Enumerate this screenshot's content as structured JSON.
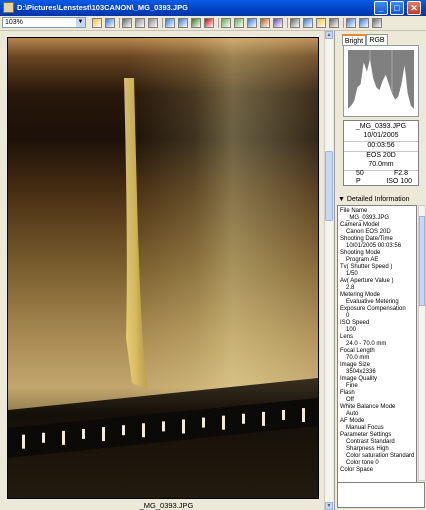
{
  "window": {
    "title": "D:\\Pictures\\Lenstest\\103CANON\\_MG_0393.JPG",
    "controls": {
      "minimize": "_",
      "maximize": "□",
      "close": "✕"
    }
  },
  "toolbar": {
    "zoom_value": "103%",
    "zoom_options": [
      "103%"
    ],
    "icons": [
      "open-folder-icon",
      "save-icon",
      "print-icon",
      "copy-icon",
      "paste-icon",
      "rotate-left-icon",
      "rotate-right-icon",
      "check-icon",
      "delete-icon",
      "image-icon",
      "image-compare-icon",
      "info-icon",
      "tool-icon",
      "format-icon",
      "view-icon",
      "search-icon",
      "folder-icon",
      "layout-icon",
      "zoom-icon",
      "help-icon",
      "grid-icon"
    ]
  },
  "image": {
    "caption": "_MG_0393.JPG",
    "ruler_ticks": 15
  },
  "panel": {
    "tabs": [
      {
        "label": "Bright",
        "active": true
      },
      {
        "label": "RGB",
        "active": false
      }
    ],
    "histogram": {
      "levels": [
        0.05,
        0.1,
        0.18,
        0.4,
        0.45,
        0.8,
        0.65,
        0.85,
        0.55,
        0.4,
        0.35,
        0.5,
        0.6,
        0.45,
        0.3,
        0.2,
        0.25,
        0.45,
        0.75,
        0.3,
        0.1,
        0.05
      ]
    },
    "info": {
      "filename": "_MG_0393.JPG",
      "date": "10/01/2005",
      "time": "00:03:56",
      "camera": "EOS 20D",
      "focal": "70.0mm",
      "shutter": "50",
      "aperture": "F2.8",
      "mode": "P",
      "iso": "ISO 100"
    },
    "detail_header": "▼ Detailed Information",
    "details": [
      {
        "label": "File Name",
        "value": "_MG_0393.JPG"
      },
      {
        "label": "Camera Model",
        "value": "Canon EOS 20D"
      },
      {
        "label": "Shooting Date/Time",
        "value": "10/01/2005 00:03:56"
      },
      {
        "label": "Shooting Mode",
        "value": "Program AE"
      },
      {
        "label": "Tv( Shutter Speed )",
        "value": "1/50"
      },
      {
        "label": "Av( Aperture Value )",
        "value": "2.8"
      },
      {
        "label": "Metering Mode",
        "value": "Evaluative Metering"
      },
      {
        "label": "Exposure Compensation",
        "value": "0"
      },
      {
        "label": "ISO Speed",
        "value": "100"
      },
      {
        "label": "Lens",
        "value": "24.0 - 70.0 mm"
      },
      {
        "label": "Focal Length",
        "value": "70.0 mm"
      },
      {
        "label": "Image Size",
        "value": "3504x2336"
      },
      {
        "label": "Image Quality",
        "value": "Fine"
      },
      {
        "label": "Flash",
        "value": "Off"
      },
      {
        "label": "White Balance Mode",
        "value": "Auto"
      },
      {
        "label": "AF Mode",
        "value": "Manual Focus"
      },
      {
        "label": "Parameter Settings",
        "value": "Contrast  Standard"
      },
      {
        "label": "",
        "value": "Sharpness  High"
      },
      {
        "label": "",
        "value": "Color saturation  Standard"
      },
      {
        "label": "",
        "value": "Color tone   0"
      },
      {
        "label": "Color Space",
        "value": ""
      }
    ]
  }
}
